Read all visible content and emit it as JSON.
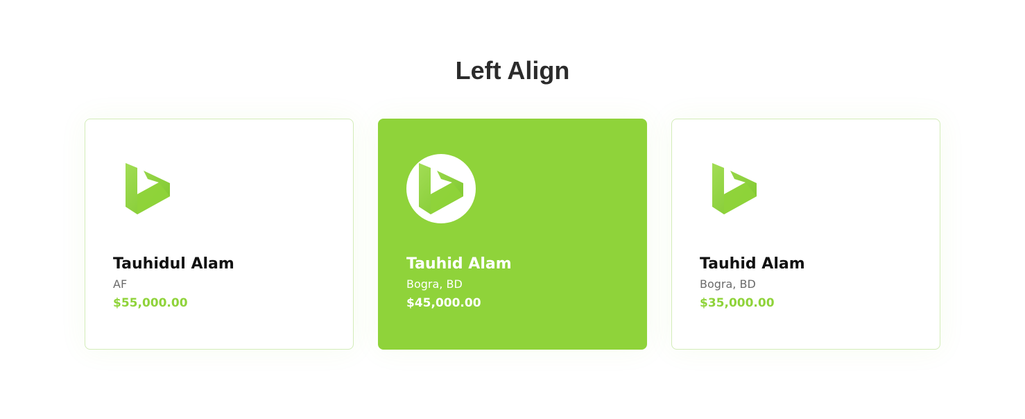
{
  "section": {
    "title": "Left Align"
  },
  "colors": {
    "accent": "#8fd33a",
    "heading": "#2b2b2b",
    "card_border": "#d3ecb9",
    "muted_text": "#6b6b6b"
  },
  "cards": [
    {
      "icon": "bing-logo-icon",
      "name": "Tauhidul Alam",
      "location": "AF",
      "price": "$55,000.00",
      "active": false
    },
    {
      "icon": "bing-logo-icon",
      "name": "Tauhid Alam",
      "location": "Bogra, BD",
      "price": "$45,000.00",
      "active": true
    },
    {
      "icon": "bing-logo-icon",
      "name": "Tauhid Alam",
      "location": "Bogra, BD",
      "price": "$35,000.00",
      "active": false
    }
  ]
}
